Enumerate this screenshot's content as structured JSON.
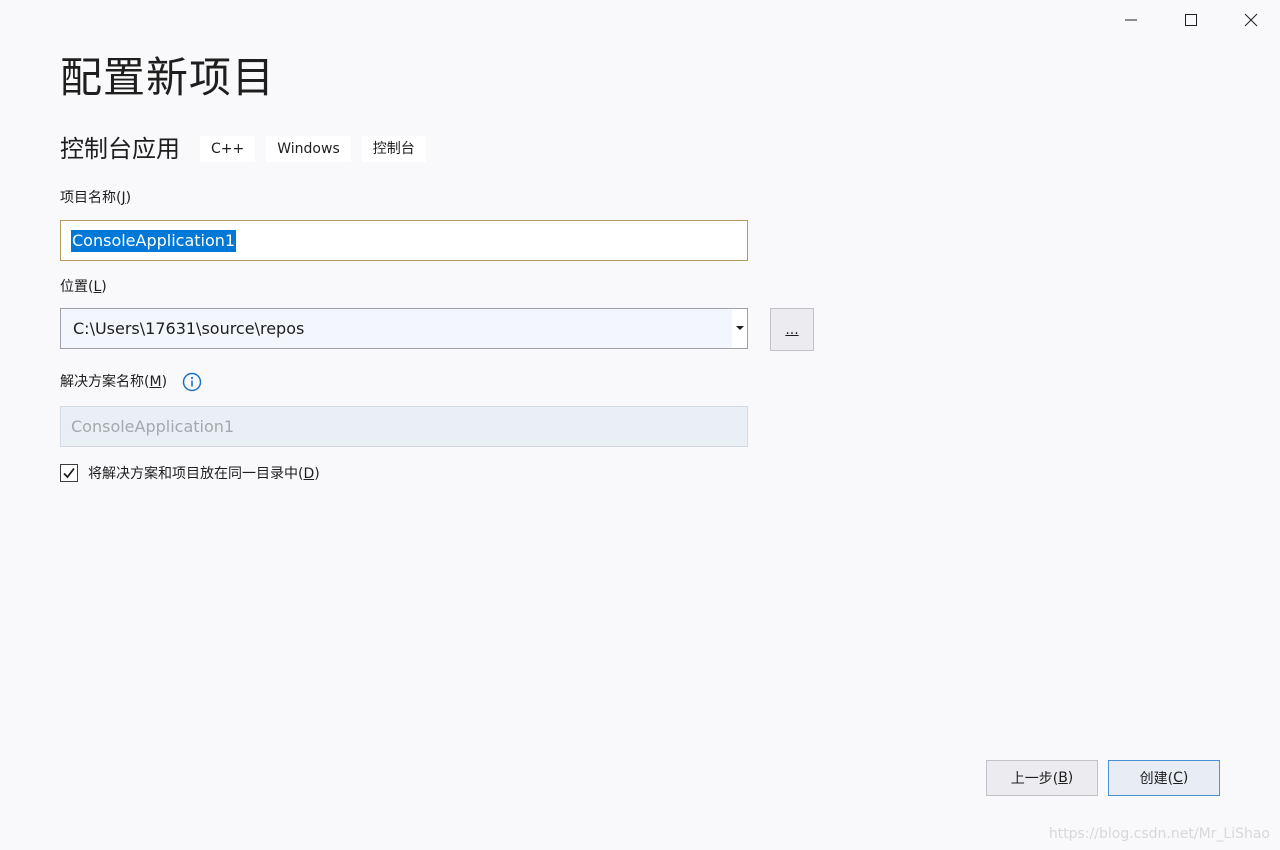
{
  "window_controls": {
    "minimize_icon": "minimize-icon",
    "maximize_icon": "maximize-icon",
    "close_icon": "close-icon"
  },
  "header": {
    "title": "配置新项目",
    "template_name": "控制台应用",
    "tags": [
      "C++",
      "Windows",
      "控制台"
    ]
  },
  "project_name": {
    "label": "项目名称(",
    "access_key": "J",
    "label_end": ")",
    "value": "ConsoleApplication1"
  },
  "location": {
    "label": "位置(",
    "access_key": "L",
    "label_end": ")",
    "value": "C:\\Users\\17631\\source\\repos",
    "browse_label": "..."
  },
  "solution_name": {
    "label": "解决方案名称(",
    "access_key": "M",
    "label_end": ")",
    "placeholder": "ConsoleApplication1",
    "info_icon": "info-icon"
  },
  "same_dir": {
    "checked": true,
    "label": "将解决方案和项目放在同一目录中(",
    "access_key": "D",
    "label_end": ")"
  },
  "footer": {
    "back_label": "上一步(",
    "back_key": "B",
    "create_label": "创建(",
    "create_key": "C",
    "label_end": ")"
  },
  "watermark": "https://blog.csdn.net/Mr_LiShao",
  "colors": {
    "background": "#f9f9fb",
    "selection": "#0078d7",
    "name_border": "#b39b5a",
    "primary_border": "#4a90d9",
    "info": "#1a73c8"
  }
}
